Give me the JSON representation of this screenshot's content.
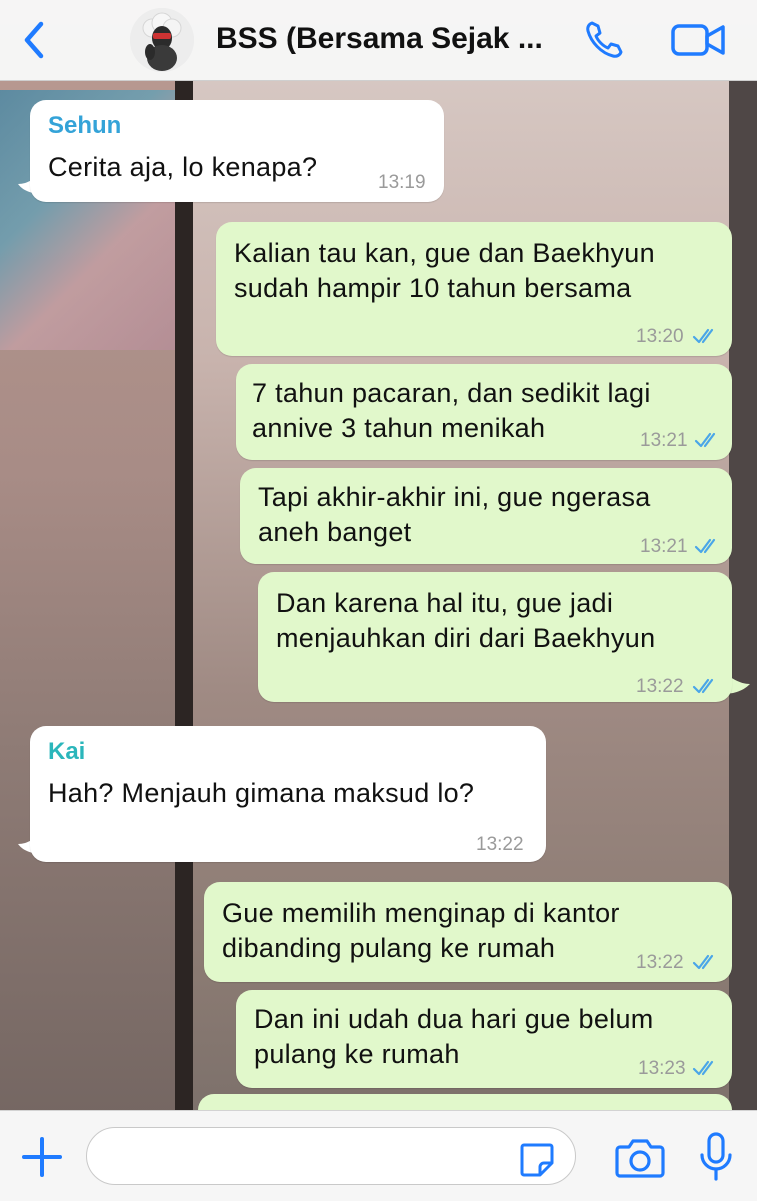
{
  "header": {
    "title": "BSS (Bersama Sejak ...",
    "back_icon": "chevron-left-icon",
    "avatar": "group-avatar",
    "call_icon": "phone-icon",
    "video_icon": "video-camera-icon"
  },
  "messages": [
    {
      "type": "in",
      "sender": "Sehun",
      "sender_color": "#34a3d8",
      "text": "Cerita aja, lo kenapa?",
      "time": "13:19"
    },
    {
      "type": "out",
      "lines": [
        "Kalian tau kan, gue dan Baekhyun",
        "sudah hampir 10 tahun bersama"
      ],
      "time": "13:20",
      "status": "read"
    },
    {
      "type": "out",
      "lines": [
        "7 tahun pacaran, dan sedikit lagi",
        "annive 3 tahun menikah"
      ],
      "time": "13:21",
      "status": "read"
    },
    {
      "type": "out",
      "lines": [
        "Tapi akhir-akhir ini, gue ngerasa",
        "aneh banget"
      ],
      "time": "13:21",
      "status": "read"
    },
    {
      "type": "out",
      "lines": [
        "Dan karena hal itu, gue jadi",
        "menjauhkan diri dari Baekhyun"
      ],
      "time": "13:22",
      "status": "read"
    },
    {
      "type": "in",
      "sender": "Kai",
      "sender_color": "#2bb6bb",
      "text": "Hah? Menjauh gimana maksud lo?",
      "time": "13:22"
    },
    {
      "type": "out",
      "lines": [
        "Gue memilih menginap di kantor",
        "dibanding pulang ke rumah"
      ],
      "time": "13:22",
      "status": "read"
    },
    {
      "type": "out",
      "lines": [
        "Dan ini udah dua hari gue belum",
        "pulang ke rumah"
      ],
      "time": "13:23",
      "status": "read"
    }
  ],
  "colors": {
    "incoming_bubble": "#ffffff",
    "outgoing_bubble": "#e1f8cb",
    "accent": "#1f7bff",
    "read_ticks": "#4aa6e8"
  },
  "input": {
    "placeholder": "",
    "plus_icon": "plus-icon",
    "sticker_icon": "sticker-icon",
    "camera_icon": "camera-icon",
    "mic_icon": "microphone-icon"
  }
}
